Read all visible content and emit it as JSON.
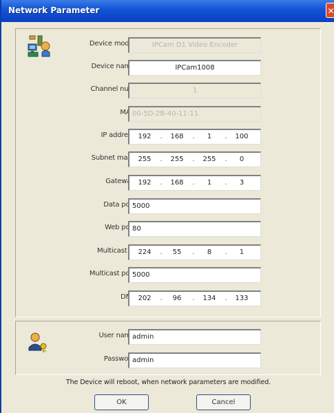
{
  "window": {
    "title": "Network Parameter",
    "close_symbol": "✕"
  },
  "icons": {
    "device": "network-device-icon",
    "user": "user-keys-icon"
  },
  "fields": {
    "device_model": {
      "label": "Device model",
      "value": "IPCam D1 Video Encoder"
    },
    "device_name": {
      "label": "Device name",
      "value": "IPCam1008"
    },
    "channel_num": {
      "label": "Channel num",
      "value": "1"
    },
    "mac": {
      "label": "MAC",
      "value": "00-5D-2B-40-11-11"
    },
    "ip_address": {
      "label": "IP address",
      "octets": [
        "192",
        "168",
        "1",
        "100"
      ]
    },
    "subnet_mask": {
      "label": "Subnet mask",
      "octets": [
        "255",
        "255",
        "255",
        "0"
      ]
    },
    "gateway": {
      "label": "Gateway",
      "octets": [
        "192",
        "168",
        "1",
        "3"
      ]
    },
    "data_port": {
      "label": "Data port",
      "value": "5000"
    },
    "web_port": {
      "label": "Web port",
      "value": "80"
    },
    "multicast_ip": {
      "label": "Multicast IP",
      "octets": [
        "224",
        "55",
        "8",
        "1"
      ]
    },
    "multicast_port": {
      "label": "Multicast port",
      "value": "5000"
    },
    "dns": {
      "label": "DNS",
      "octets": [
        "202",
        "96",
        "134",
        "133"
      ]
    },
    "user_name": {
      "label": "User name",
      "value": "admin"
    },
    "password": {
      "label": "Password",
      "value": "admin"
    }
  },
  "notice": "The Device will reboot, when network parameters are modified.",
  "buttons": {
    "ok": "OK",
    "cancel": "Cancel"
  },
  "colors": {
    "title_bar": "#0b3fc2",
    "window_bg": "#ece9d8",
    "close_button": "#d8492d"
  }
}
